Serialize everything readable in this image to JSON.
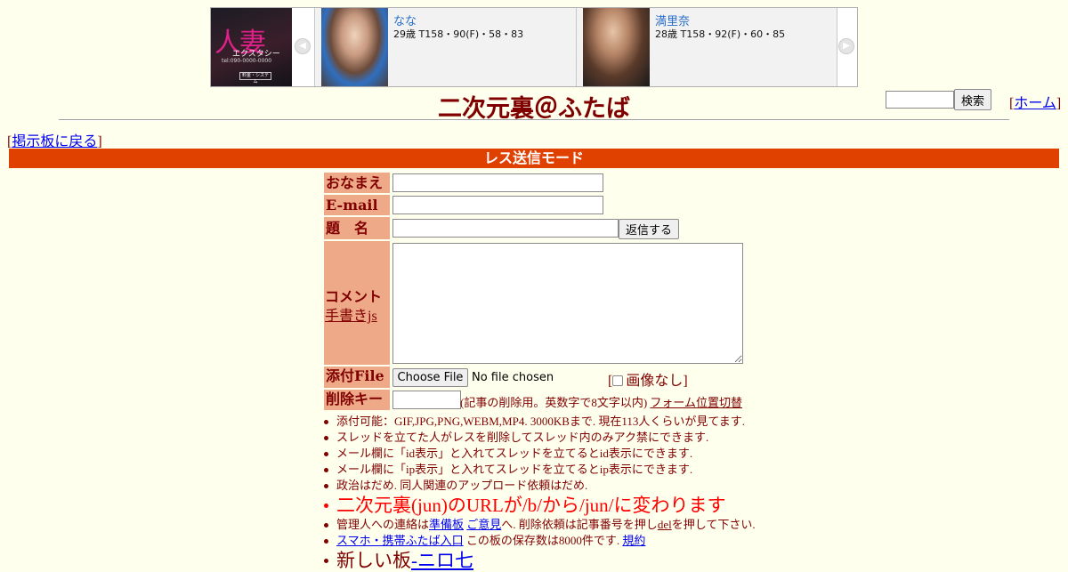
{
  "ad": {
    "logo_big": "人妻",
    "logo_mid": "エクスタシー",
    "logo_small": "tel:090-0000-0000",
    "logo_btn": "料金・システム",
    "cards": [
      {
        "name": "なな",
        "info": "29歳 T158・90(F)・58・83"
      },
      {
        "name": "満里奈",
        "info": "28歳 T158・92(F)・60・85"
      }
    ]
  },
  "header": {
    "title": "二次元裏＠ふたば",
    "search_button": "検索",
    "home_link": "ホーム",
    "back_link": "掲示板に戻る"
  },
  "form": {
    "mode_title": "レス送信モード",
    "name_label": "おなまえ",
    "email_label": "E-mail",
    "subject_label": "題　名",
    "submit_button": "返信する",
    "comment_label": "コメント",
    "tegaki_link": "手書きjs",
    "file_label": "添付File",
    "file_button": "Choose File",
    "file_status": "No file chosen",
    "no_image_label": "画像なし",
    "delkey_label": "削除キー",
    "delkey_note": "(記事の削除用。英数字で8文字以内)",
    "form_position_link": "フォーム位置切替"
  },
  "rules": {
    "upload": "添付可能：GIF,JPG,PNG,WEBM,MP4. 3000KBまで. 現在113人くらいが見てます.",
    "thread_ban": "スレッドを立てた人がレスを削除してスレッド内のみアク禁にできます.",
    "id_display": "メール欄に「id表示」と入れてスレッドを立てるとid表示にできます.",
    "ip_display": "メール欄に「ip表示」と入れてスレッドを立てるとip表示にできます.",
    "politics": "政治はだめ. 同人関連のアップロード依頼はだめ.",
    "url_change": "二次元裏(jun)のURLが/b/から/jun/に変わります",
    "contact_prefix": "管理人への連絡は",
    "contact_link1": "準備板",
    "contact_link2": "ご意見",
    "contact_mid": "へ. 削除依頼は記事番号を押し",
    "contact_del": "del",
    "contact_suffix": "を押して下さい.",
    "mobile_link": "スマホ・携帯ふたば入口",
    "retention": " この板の保存数は8000件です.",
    "terms_link": "規約",
    "new_board_prefix": "新しい板",
    "new_board_link": "-ニロ七"
  }
}
